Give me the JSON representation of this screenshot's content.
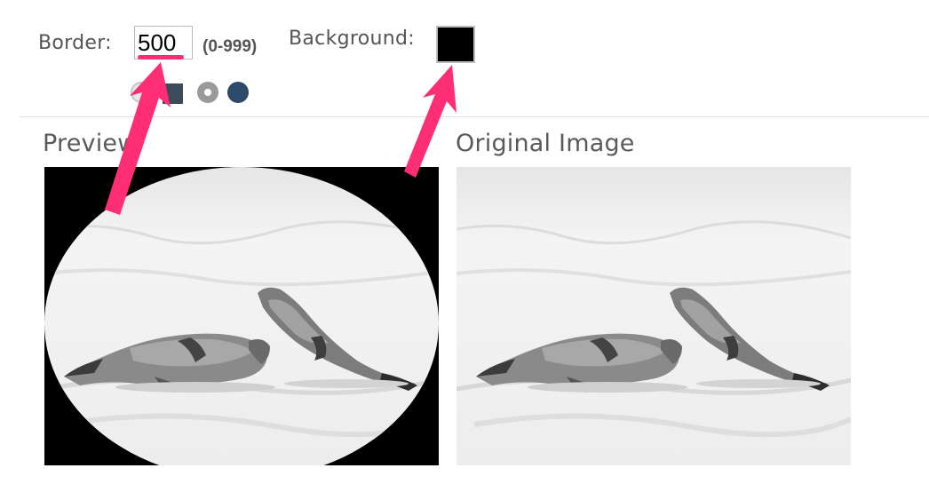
{
  "controls": {
    "border_label": "Border:",
    "border_value": "500",
    "border_range_hint": "(0-999)",
    "background_label": "Background:",
    "background_color": "#000000",
    "shapes": [
      {
        "name": "circle-outline",
        "icon": "circle-outline-icon"
      },
      {
        "name": "square",
        "icon": "square-icon"
      },
      {
        "name": "radio-circle",
        "icon": "ring-icon"
      },
      {
        "name": "circle",
        "icon": "filled-circle-icon"
      }
    ]
  },
  "sections": {
    "preview_title": "Preview",
    "original_title": "Original Image"
  },
  "colors": {
    "annotation_pink": "#ff2d74",
    "shape_dark": "#3d4a5a",
    "shape_gray": "#9a9a9a",
    "shape_navy": "#2e4a6b",
    "text_gray": "#555555"
  }
}
